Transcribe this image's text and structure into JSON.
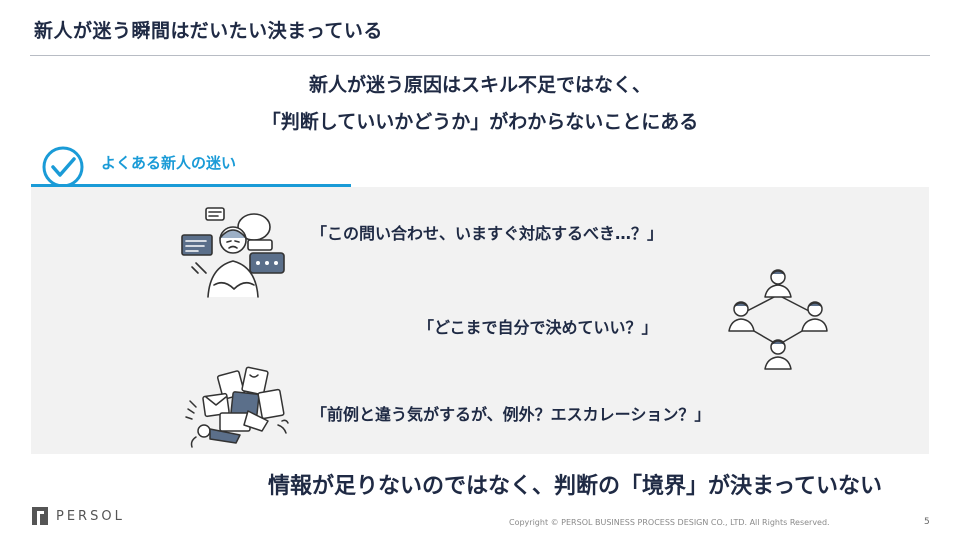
{
  "slide": {
    "title": "新人が迷う瞬間はだいたい決まっている",
    "headline_line1": "新人が迷う原因はスキル不足ではなく、",
    "headline_line2": "「判断していいかどうか」がわからないことにある",
    "section_label": "よくある新人の迷い",
    "quotes": [
      "「この問い合わせ、いますぐ対応するべき…？」",
      "「どこまで自分で決めていい？」",
      "「前例と違う気がするが、例外？エスカレーション？」"
    ],
    "conclusion": "情報が足りないのではなく、判断の「境界」が決まっていない"
  },
  "footer": {
    "logo_text": "PERSOL",
    "copyright": "Copyright © PERSOL BUSINESS PROCESS DESIGN CO., LTD. All Rights Reserved.",
    "page_number": "5"
  },
  "icons": {
    "section": "check-circle-icon",
    "illustration_1": "confused-person-speech-bubbles-icon",
    "illustration_2": "team-network-icon",
    "illustration_3": "person-overwhelmed-by-documents-icon"
  },
  "colors": {
    "navy": "#1f2a44",
    "accent_blue": "#1a9bd7",
    "panel_gray": "#f2f2f2"
  }
}
